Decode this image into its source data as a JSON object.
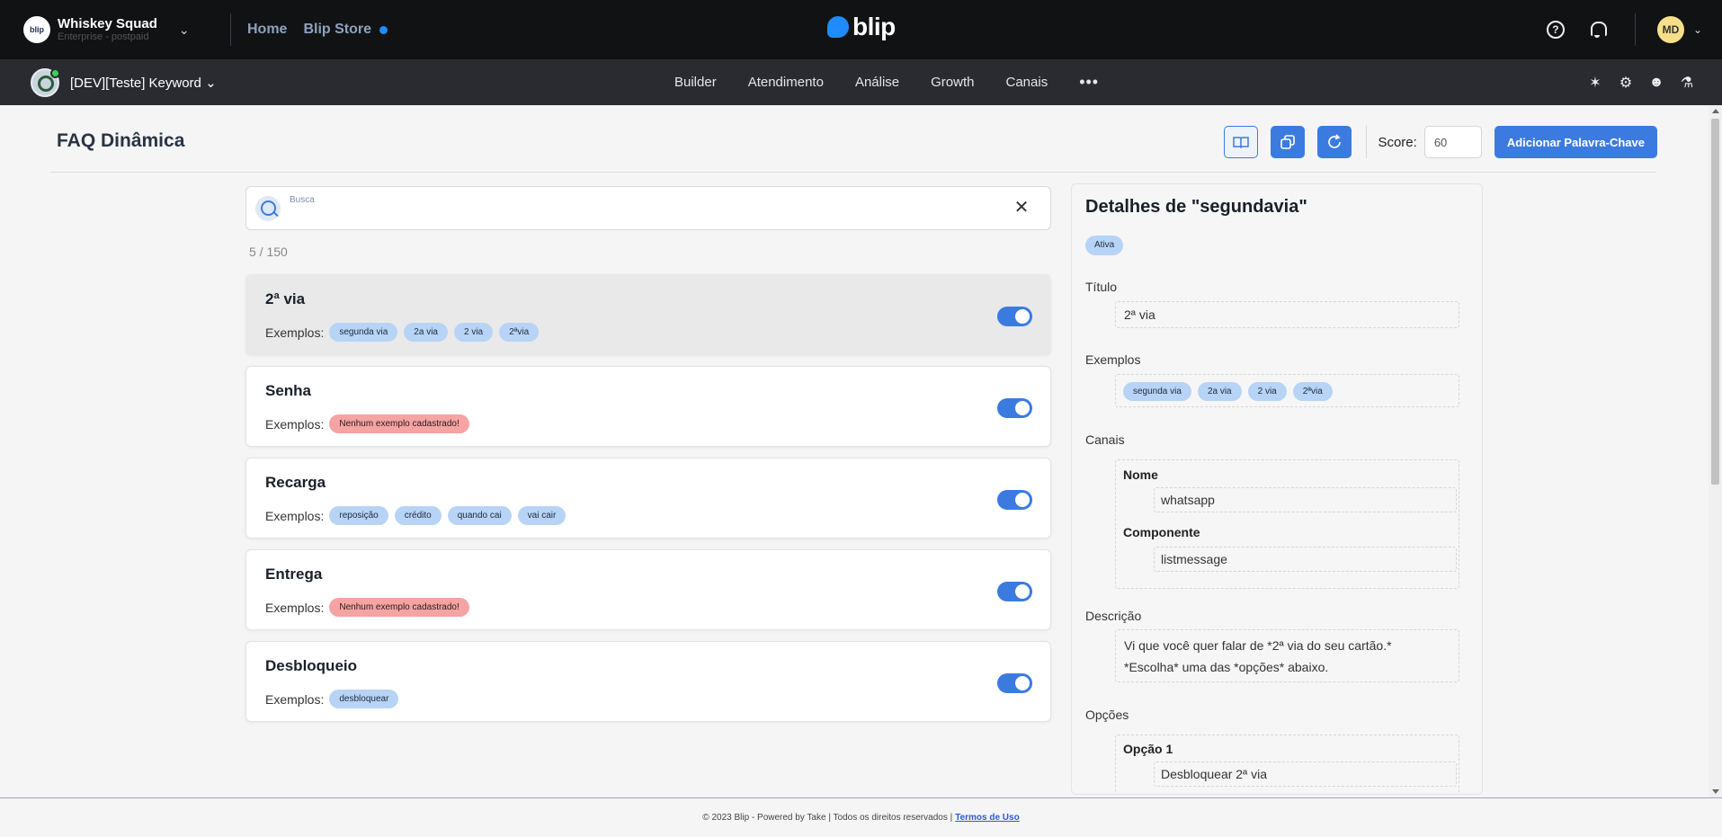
{
  "topbar": {
    "org_name": "Whiskey Squad",
    "org_plan": "Enterprise - postpaid",
    "org_logo_text": "blip",
    "links": [
      "Home",
      "Blip Store"
    ],
    "brand": "blip",
    "help_icon_text": "?",
    "avatar_initials": "MD"
  },
  "subbar": {
    "bot_name": "[DEV][Teste] Keyword",
    "nav": [
      "Builder",
      "Atendimento",
      "Análise",
      "Growth",
      "Canais"
    ],
    "more": "•••"
  },
  "header": {
    "title": "FAQ Dinâmica",
    "score_label": "Score:",
    "score_value": "60",
    "add_button": "Adicionar Palavra-Chave"
  },
  "search": {
    "label": "Busca",
    "value": "",
    "clear": "✕"
  },
  "counter": "5 / 150",
  "examples_label": "Exemplos:",
  "cards": [
    {
      "title": "2ª via",
      "selected": true,
      "active": true,
      "examples": [
        "segunda via",
        "2a via",
        "2 via",
        "2ªvia"
      ],
      "empty": false
    },
    {
      "title": "Senha",
      "selected": false,
      "active": true,
      "examples": [
        "Nenhum exemplo cadastrado!"
      ],
      "empty": true
    },
    {
      "title": "Recarga",
      "selected": false,
      "active": true,
      "examples": [
        "reposição",
        "crédito",
        "quando cai",
        "vai cair"
      ],
      "empty": false
    },
    {
      "title": "Entrega",
      "selected": false,
      "active": true,
      "examples": [
        "Nenhum exemplo cadastrado!"
      ],
      "empty": true
    },
    {
      "title": "Desbloqueio",
      "selected": false,
      "active": true,
      "examples": [
        "desbloquear"
      ],
      "empty": false
    }
  ],
  "details": {
    "title": "Detalhes de \"segundavia\"",
    "status": "Ativa",
    "titulo_label": "Título",
    "titulo_value": "2ª via",
    "exemplos_label": "Exemplos",
    "exemplos": [
      "segunda via",
      "2a via",
      "2 via",
      "2ªvia"
    ],
    "canais_label": "Canais",
    "nome_label": "Nome",
    "nome_value": "whatsapp",
    "componente_label": "Componente",
    "componente_value": "listmessage",
    "descricao_label": "Descrição",
    "descricao_line1": "Vi que você quer falar de *2ª via do seu cartão.*",
    "descricao_line2": "*Escolha* uma das *opções* abaixo.",
    "opcoes_label": "Opções",
    "opcao1_label": "Opção 1",
    "opcao1_value": "Desbloquear 2ª via"
  },
  "footer": {
    "text": "© 2023 Blip - Powered by Take | Todos os direitos reservados |",
    "link": "Termos de Uso"
  },
  "colors": {
    "accent": "#3b7be0",
    "chip": "#b7d4f6",
    "chip_empty": "#f5a3a3",
    "topbar": "#111214",
    "subbar": "#292b30"
  }
}
